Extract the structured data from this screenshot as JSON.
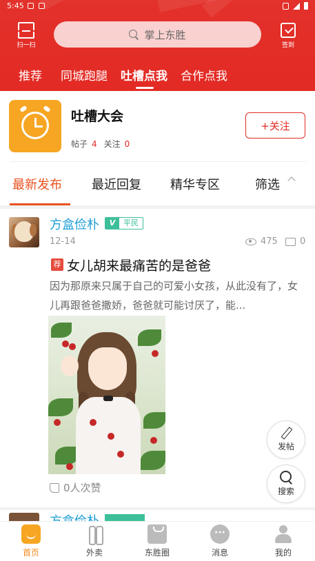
{
  "status_bar": {
    "time": "5:45"
  },
  "header": {
    "scan_label": "扫一扫",
    "search_placeholder": "掌上东胜",
    "checkin_label": "签到",
    "tabs": [
      {
        "label": "推荐",
        "active": false
      },
      {
        "label": "同城跑腿",
        "active": false
      },
      {
        "label": "吐槽点我",
        "active": true
      },
      {
        "label": "合作点我",
        "active": false
      }
    ]
  },
  "group": {
    "name": "吐槽大会",
    "posts_label": "帖子",
    "posts_count": "4",
    "followers_label": "关注",
    "followers_count": "0",
    "follow_button": "+关注"
  },
  "content_tabs": [
    {
      "label": "最新发布",
      "active": true
    },
    {
      "label": "最近回复",
      "active": false
    },
    {
      "label": "精华专区",
      "active": false
    },
    {
      "label": "筛选",
      "active": false
    }
  ],
  "post": {
    "author": "方盒俭朴",
    "badge_v": "V",
    "badge_level": "平民",
    "date": "12-14",
    "views": "475",
    "comments": "0",
    "recommend_tag": "荐",
    "title": "女儿胡来最痛苦的是爸爸",
    "excerpt": "因为那原来只属于自己的可爱小女孩，从此没有了，女儿再跟爸爸撒娇，爸爸就可能讨厌了，能...",
    "likes": "0人次赞"
  },
  "next_post": {
    "author": "方盒俭朴"
  },
  "fabs": {
    "post_label": "发帖",
    "search_label": "搜索"
  },
  "bottom_nav": [
    {
      "label": "首页",
      "active": true,
      "icon": "home-icon"
    },
    {
      "label": "外卖",
      "active": false,
      "icon": "food-icon"
    },
    {
      "label": "东胜圈",
      "active": false,
      "icon": "circle-bag-icon"
    },
    {
      "label": "消息",
      "active": false,
      "icon": "message-icon"
    },
    {
      "label": "我的",
      "active": false,
      "icon": "profile-icon"
    }
  ],
  "colors": {
    "brand_red": "#e32a24",
    "tab_active": "#e8511f",
    "author_blue": "#1f9fd6",
    "badge_green": "#3dbf9a",
    "nav_active": "#f08a1c"
  }
}
